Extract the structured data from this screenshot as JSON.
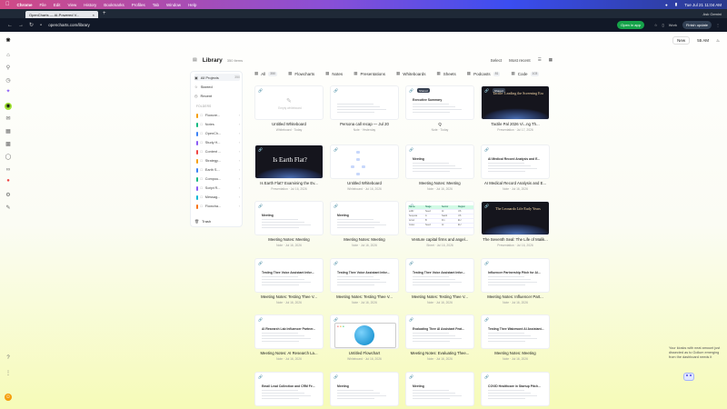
{
  "menubar": {
    "items": [
      "Chrome",
      "File",
      "Edit",
      "View",
      "History",
      "Bookmarks",
      "Profiles",
      "Tab",
      "Window",
      "Help"
    ],
    "clock": "Tue Jul 21  11:04 AM"
  },
  "browser": {
    "tab_title": "OpenCharts — AI-Powered V...",
    "url": "opencharts.com/library",
    "open_in_app": "Open in app",
    "work_profile": "Work",
    "finish_update": "Finish update",
    "ask_gemini": "Ask Gemini"
  },
  "topbar": {
    "new_label": "New",
    "time_label": "55 AM"
  },
  "library": {
    "title": "Library",
    "count": "350 items",
    "select_label": "Select",
    "sort_label": "Most recent"
  },
  "sidebar": {
    "all_projects": "All Projects",
    "all_count": "350",
    "starred": "Starred",
    "recent": "Recent",
    "folders_label": "FOLDERS",
    "folders": [
      {
        "name": "Flowcre...",
        "color": "#f59e0b"
      },
      {
        "name": "Notes",
        "color": "#10b981"
      },
      {
        "name": "OpenCh...",
        "color": "#3b82f6"
      },
      {
        "name": "Study H...",
        "color": "#8b5cf6"
      },
      {
        "name": "Content ...",
        "color": "#ef4444"
      },
      {
        "name": "Strategy...",
        "color": "#f59e0b"
      },
      {
        "name": "Earth S...",
        "color": "#3b82f6"
      },
      {
        "name": "Compou...",
        "color": "#10b981"
      },
      {
        "name": "Script R...",
        "color": "#8b5cf6"
      },
      {
        "name": "Messag...",
        "color": "#06b6d4"
      },
      {
        "name": "Flowcha...",
        "color": "#f97316"
      }
    ],
    "trash": "Trash"
  },
  "filters": [
    {
      "label": "All",
      "count": "350",
      "icon": "grid-icon"
    },
    {
      "label": "Flowcharts",
      "count": "",
      "icon": "flowchart-icon"
    },
    {
      "label": "Notes",
      "count": "",
      "icon": "note-icon"
    },
    {
      "label": "Presentations",
      "count": "",
      "icon": "presentation-icon"
    },
    {
      "label": "Whiteboards",
      "count": "",
      "icon": "whiteboard-icon"
    },
    {
      "label": "Sheets",
      "count": "",
      "icon": "sheet-icon"
    },
    {
      "label": "Podcasts",
      "count": "81",
      "icon": "podcast-icon"
    },
    {
      "label": "Code",
      "count": "103",
      "icon": "code-icon"
    }
  ],
  "cards": [
    {
      "title": "Untitled Whiteboard",
      "meta": "Whiteboard · Today",
      "kind": "whiteboard-empty",
      "thumb_text": "Empty whiteboard"
    },
    {
      "title": "Persona call recap — Jul 20",
      "meta": "Note · Yesterday",
      "kind": "doc",
      "doc_title": ""
    },
    {
      "title": "Q",
      "meta": "Note · Today",
      "kind": "doc",
      "doc_title": "Executive Summary",
      "badge": "Shared"
    },
    {
      "title": "Tactile Pal 2026 Vi...ng Th...",
      "meta": "Presentation · Jul 17, 2026",
      "kind": "dark",
      "dark_title": "",
      "dark_sub": "Tactile: Leading the Screening Era",
      "badge": "Shared"
    },
    {
      "title": "Is Earth Flat? Examining the Ev...",
      "meta": "Presentation · Jul 16, 2026",
      "kind": "dark",
      "dark_title": "Is Earth Flat?",
      "dark_sub": ""
    },
    {
      "title": "Untitled Whiteboard",
      "meta": "Whiteboard · Jul 16, 2026",
      "kind": "whiteboard-nodes"
    },
    {
      "title": "Meeting Notes: Meeting",
      "meta": "Note · Jul 16, 2026",
      "kind": "doc",
      "doc_title": "Meeting"
    },
    {
      "title": "AI Medical Record Analysis and E...",
      "meta": "Note · Jul 16, 2026",
      "kind": "doc",
      "doc_title": "AI Medical Record Analysis and E..."
    },
    {
      "title": "Meeting Notes: Meeting",
      "meta": "Note · Jul 16, 2026",
      "kind": "doc",
      "doc_title": "Meeting"
    },
    {
      "title": "Meeting Notes: Meeting",
      "meta": "Note · Jul 16, 2026",
      "kind": "doc",
      "doc_title": "Meeting"
    },
    {
      "title": "Venture capital firms and angel...",
      "meta": "Sheet · Jul 16, 2026",
      "kind": "table"
    },
    {
      "title": "The Seventh Seal: The Life of Malik...",
      "meta": "Presentation · Jul 16, 2026",
      "kind": "dark",
      "dark_title": "",
      "dark_sub": "The Leonardo Life Early Years"
    },
    {
      "title": "Meeting Notes: Testing Thee V...",
      "meta": "Note · Jul 16, 2026",
      "kind": "doc",
      "doc_title": "Testing Thee Voice Assistant Infor..."
    },
    {
      "title": "Meeting Notes: Testing Thee V...",
      "meta": "Note · Jul 16, 2026",
      "kind": "doc",
      "doc_title": "Testing Thee Voice Assistant Infor..."
    },
    {
      "title": "Meeting Notes: Testing Thee V...",
      "meta": "Note · Jul 16, 2026",
      "kind": "doc",
      "doc_title": "Testing Thee Voice Assistant Infor..."
    },
    {
      "title": "Meeting Notes: Influencer Part...",
      "meta": "Note · Jul 16, 2026",
      "kind": "doc",
      "doc_title": "Influencer Partnership Pitch for AI..."
    },
    {
      "title": "Meeting Notes: AI Research La...",
      "meta": "Note · Jul 16, 2026",
      "kind": "doc",
      "doc_title": "AI Research Lab Influencer Partner..."
    },
    {
      "title": "Untitled Flowchart",
      "meta": "Whiteboard · Jul 16, 2026",
      "kind": "flow"
    },
    {
      "title": "Meeting Notes: Evaluating Thee...",
      "meta": "Note · Jul 16, 2026",
      "kind": "doc",
      "doc_title": "Evaluating Thee AI Assistant Feat..."
    },
    {
      "title": "Meeting Notes: Meeting",
      "meta": "Note · Jul 16, 2026",
      "kind": "doc",
      "doc_title": "Testing Thee Wakeword AI Assistant..."
    },
    {
      "title": "",
      "meta": "",
      "kind": "doc",
      "doc_title": "Email Lead Collection and CRM Fe..."
    },
    {
      "title": "",
      "meta": "",
      "kind": "doc",
      "doc_title": "Meeting"
    },
    {
      "title": "",
      "meta": "",
      "kind": "doc",
      "doc_title": "Meeting"
    },
    {
      "title": "",
      "meta": "",
      "kind": "doc",
      "doc_title": "COVID Healthcare in Startup Pitch..."
    }
  ],
  "sheet_preview": {
    "headers": [
      "Name",
      "Stage",
      "Sector",
      "Region"
    ],
    "rows": [
      [
        "a16z",
        "Seed",
        "AI",
        "US"
      ],
      [
        "Sequoia",
        "A",
        "SaaS",
        "US"
      ],
      [
        "Accel",
        "B",
        "Fin",
        "EU"
      ],
      [
        "Index",
        "Seed",
        "AI",
        "EU"
      ]
    ]
  },
  "chat": {
    "message": "Your kiosks with neat amount just dissected as to Gollum emerging from the dashboard needs it"
  },
  "colors": {
    "accent": "#3b82f6",
    "bg_bottom": "#f6fbb8"
  }
}
